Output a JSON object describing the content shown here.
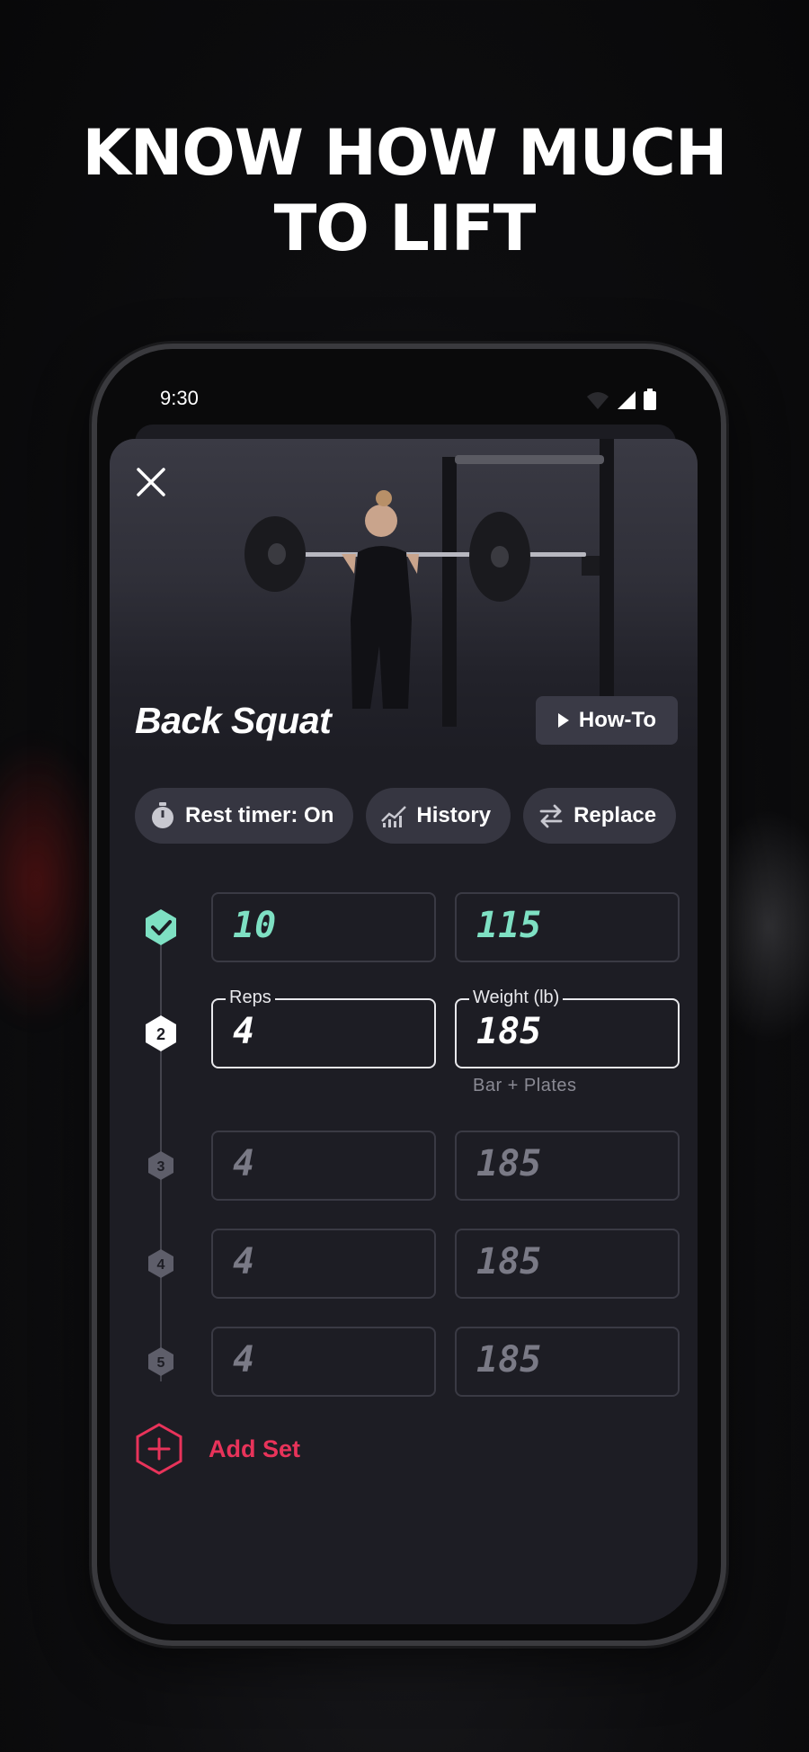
{
  "headline": {
    "line1": "KNOW HOW MUCH",
    "line2": "TO LIFT"
  },
  "status_bar": {
    "time": "9:30",
    "icons": [
      "wifi-icon",
      "cell-signal-icon",
      "battery-icon"
    ]
  },
  "exercise": {
    "title": "Back Squat",
    "how_to_label": "How-To",
    "close_icon": "close-icon"
  },
  "chips": [
    {
      "label": "Rest timer: On",
      "icon": "stopwatch-icon"
    },
    {
      "label": "History",
      "icon": "chart-icon"
    },
    {
      "label": "Replace",
      "icon": "swap-icon"
    }
  ],
  "sets": [
    {
      "marker": "check",
      "reps": "10",
      "weight": "115",
      "state": "done"
    },
    {
      "marker": "2",
      "reps": "4",
      "weight": "185",
      "state": "active",
      "reps_label": "Reps",
      "weight_label": "Weight (lb)",
      "hint": "Bar + Plates"
    },
    {
      "marker": "3",
      "reps": "4",
      "weight": "185",
      "state": "pending"
    },
    {
      "marker": "4",
      "reps": "4",
      "weight": "185",
      "state": "pending"
    },
    {
      "marker": "5",
      "reps": "4",
      "weight": "185",
      "state": "pending"
    }
  ],
  "add_set_label": "Add Set",
  "colors": {
    "accent": "#e8335a",
    "done": "#7ee0c3",
    "screen_bg": "#1d1d24",
    "chip_bg": "#363641"
  }
}
